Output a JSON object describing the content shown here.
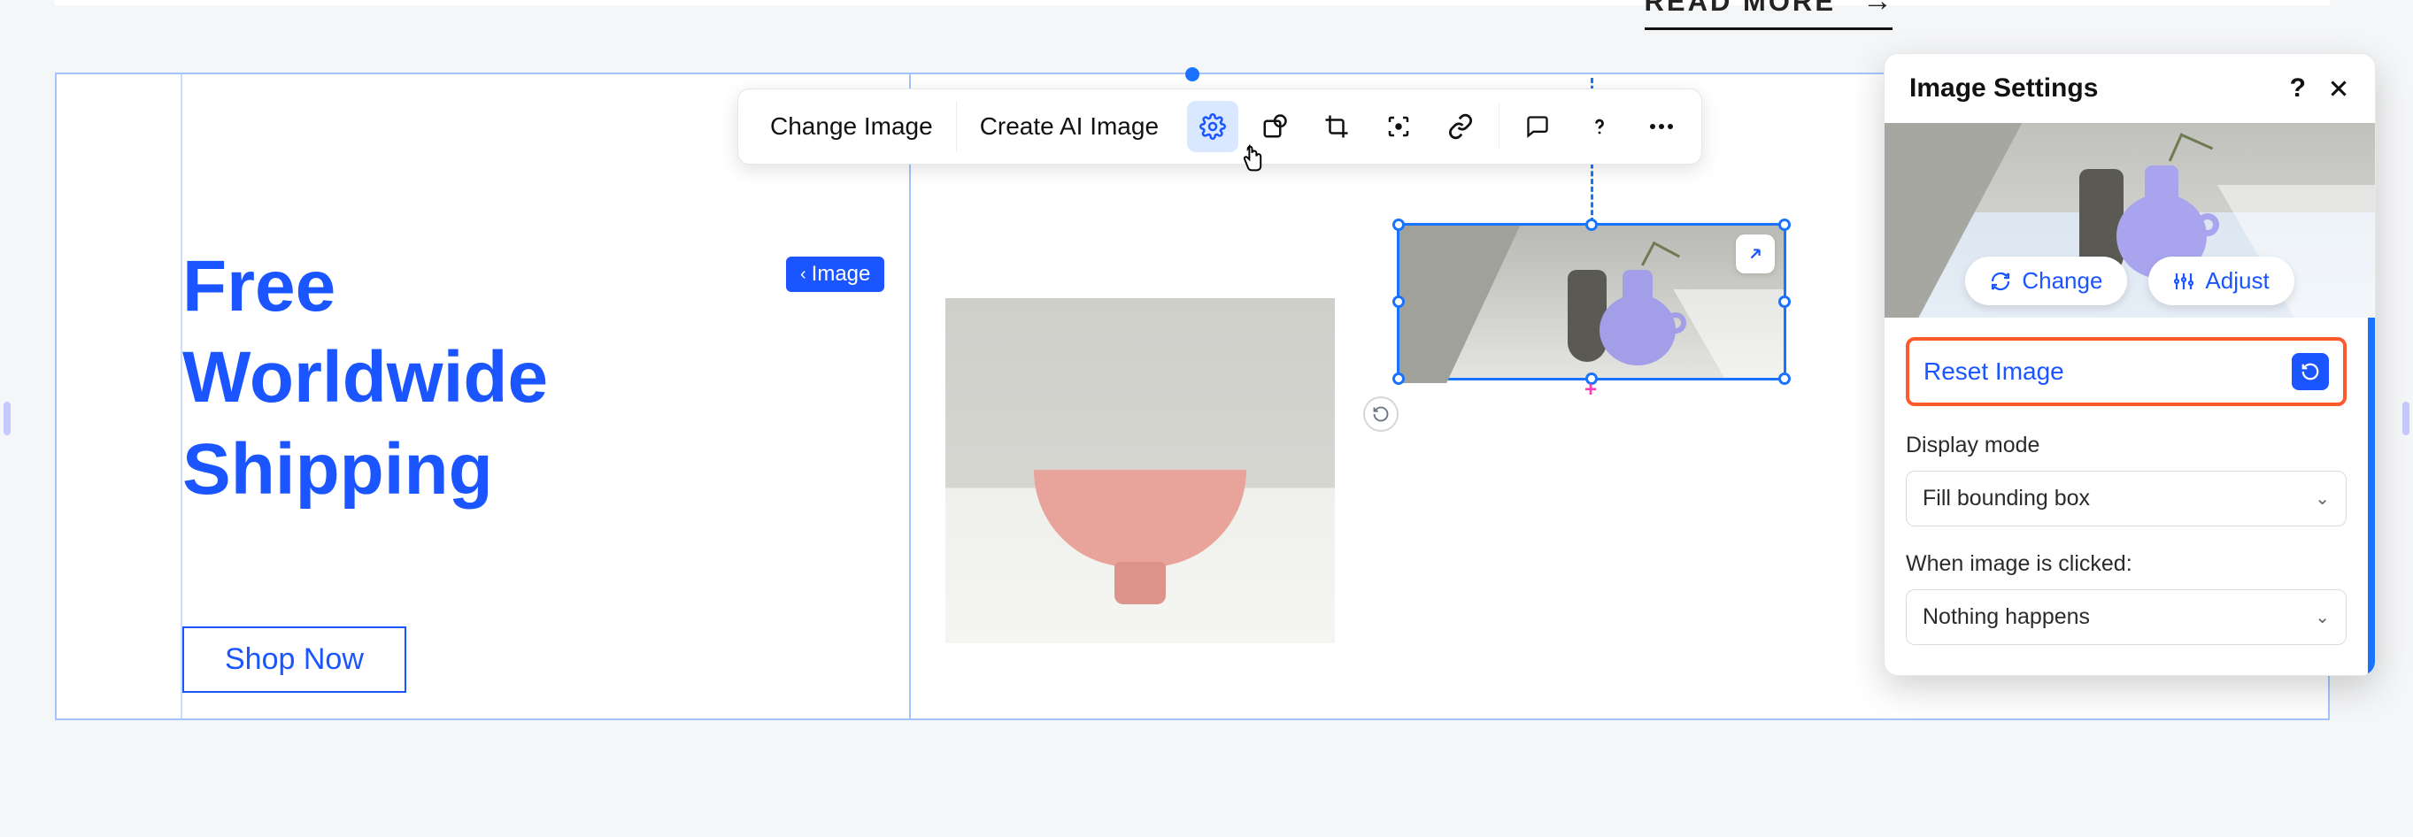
{
  "header": {
    "read_more": "READ MORE"
  },
  "canvas": {
    "hero_title_l1": "Free",
    "hero_title_l2": "Worldwide",
    "hero_title_l3": "Shipping",
    "shop_now": "Shop Now",
    "badge_image": "Image"
  },
  "toolbar": {
    "change_image": "Change Image",
    "create_ai_image": "Create AI Image"
  },
  "panel": {
    "title": "Image Settings",
    "change": "Change",
    "adjust": "Adjust",
    "reset": "Reset Image",
    "display_mode_label": "Display mode",
    "display_mode_value": "Fill bounding box",
    "click_label": "When image is clicked:",
    "click_value": "Nothing happens"
  }
}
